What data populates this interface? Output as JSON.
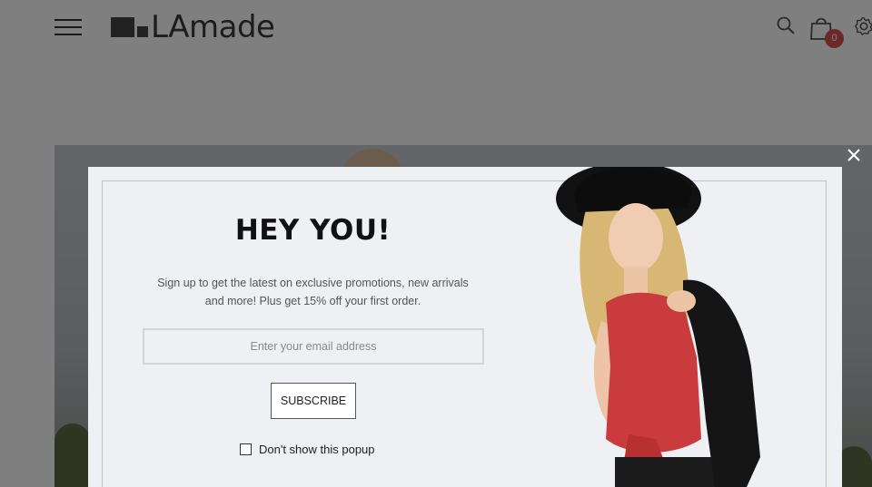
{
  "header": {
    "logo_prefix": "LA",
    "logo_text": "made",
    "cart_count": "0"
  },
  "popup": {
    "title": "HEY YOU!",
    "description_line1": "Sign up to get the latest on exclusive promotions, new arrivals",
    "description_line2": "and more! Plus get 15% off your first order.",
    "email_placeholder": "Enter your email address",
    "subscribe_label": "SUBSCRIBE",
    "dont_show_label": "Don't show this popup"
  },
  "colors": {
    "badge": "#d9534f",
    "popup_bg": "#eff0f4",
    "overlay": "rgba(0,0,0,0.5)"
  }
}
